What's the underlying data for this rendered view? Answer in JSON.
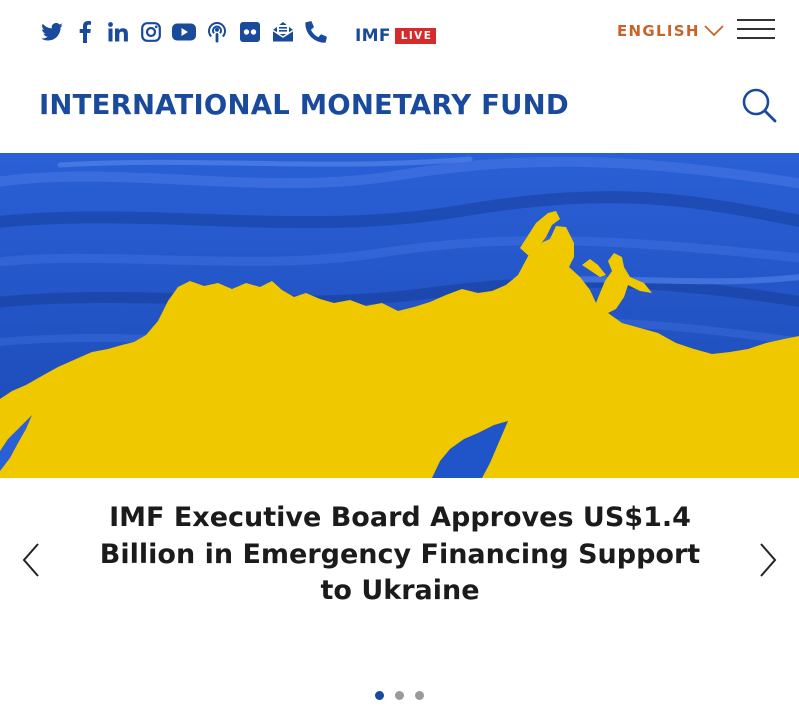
{
  "header": {
    "social_icons": [
      "twitter-icon",
      "facebook-icon",
      "linkedin-icon",
      "instagram-icon",
      "youtube-icon",
      "podcast-icon",
      "flickr-icon",
      "email-newsletter-icon",
      "phone-icon"
    ],
    "imf_live": {
      "prefix": "IMF",
      "badge": "LIVE"
    },
    "language": "ENGLISH",
    "menu_icon": "hamburger-icon"
  },
  "masthead": {
    "title": "INTERNATIONAL MONETARY FUND",
    "search_icon": "search-icon"
  },
  "hero": {
    "image": "yellow-and-blue-painted-landscape-with-climbers"
  },
  "carousel": {
    "headline": "IMF Executive Board Approves US$1.4 Billion in Emergency Financing Support to Ukraine",
    "prev_icon": "chevron-left-icon",
    "next_icon": "chevron-right-icon",
    "slide_count": 3,
    "active_slide": 1
  },
  "colors": {
    "brand_blue": "#1a4a9c",
    "language_orange": "#c8642a",
    "live_red": "#d62b2b",
    "hero_blue": "#1f55c8",
    "hero_yellow": "#f0c800"
  }
}
